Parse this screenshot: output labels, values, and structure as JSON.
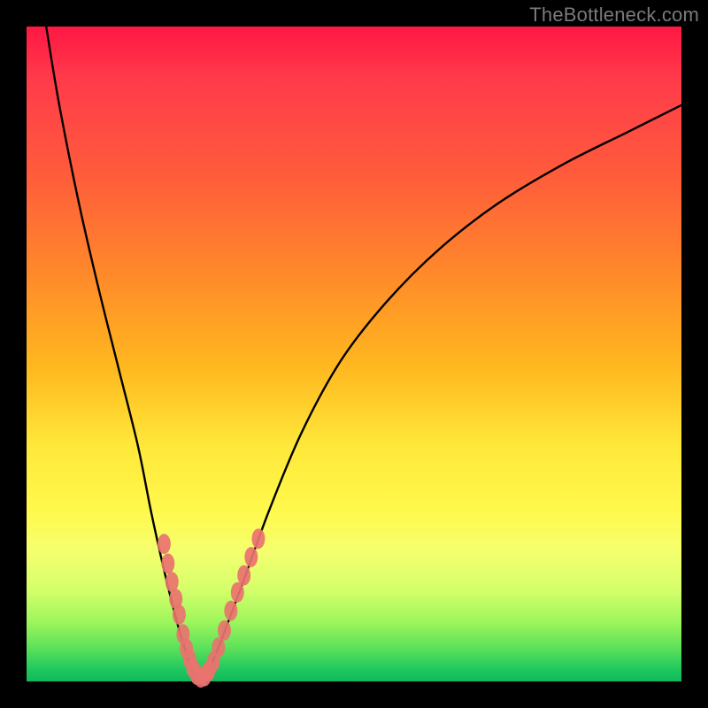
{
  "watermark": "TheBottleneck.com",
  "chart_data": {
    "type": "line",
    "title": "",
    "xlabel": "",
    "ylabel": "",
    "xlim": [
      0,
      100
    ],
    "ylim": [
      0,
      100
    ],
    "series": [
      {
        "name": "bottleneck-curve",
        "x": [
          3,
          5,
          8,
          11,
          14,
          17,
          19,
          21,
          23,
          24.5,
          26,
          27,
          28,
          30,
          33,
          37,
          42,
          48,
          55,
          63,
          72,
          82,
          92,
          100
        ],
        "y": [
          100,
          88,
          73,
          60,
          48,
          36,
          26,
          17,
          9,
          4,
          0,
          0,
          2,
          7,
          15,
          26,
          38,
          49,
          58,
          66,
          73,
          79,
          84,
          88
        ]
      }
    ],
    "markers": [
      {
        "x": 21.0,
        "y": 21.0,
        "r": 2.2
      },
      {
        "x": 21.6,
        "y": 18.0,
        "r": 2.2
      },
      {
        "x": 22.2,
        "y": 15.2,
        "r": 2.2
      },
      {
        "x": 22.8,
        "y": 12.6,
        "r": 2.2
      },
      {
        "x": 23.3,
        "y": 10.2,
        "r": 2.2
      },
      {
        "x": 23.9,
        "y": 7.2,
        "r": 2.2
      },
      {
        "x": 24.4,
        "y": 5.0,
        "r": 2.2
      },
      {
        "x": 24.9,
        "y": 3.4,
        "r": 2.2
      },
      {
        "x": 25.4,
        "y": 2.0,
        "r": 2.2
      },
      {
        "x": 26.0,
        "y": 1.0,
        "r": 2.2
      },
      {
        "x": 26.6,
        "y": 0.6,
        "r": 2.2
      },
      {
        "x": 27.2,
        "y": 0.8,
        "r": 2.2
      },
      {
        "x": 27.8,
        "y": 1.6,
        "r": 2.2
      },
      {
        "x": 28.5,
        "y": 3.0,
        "r": 2.2
      },
      {
        "x": 29.3,
        "y": 5.2,
        "r": 2.2
      },
      {
        "x": 30.2,
        "y": 7.8,
        "r": 2.2
      },
      {
        "x": 31.2,
        "y": 10.8,
        "r": 2.2
      },
      {
        "x": 32.2,
        "y": 13.6,
        "r": 2.2
      },
      {
        "x": 33.2,
        "y": 16.2,
        "r": 2.2
      },
      {
        "x": 34.3,
        "y": 19.0,
        "r": 2.2
      },
      {
        "x": 35.4,
        "y": 21.8,
        "r": 2.2
      }
    ],
    "gradient_stops": [
      {
        "pos": 0,
        "color": "#ff1744"
      },
      {
        "pos": 22,
        "color": "#ff5a3c"
      },
      {
        "pos": 52,
        "color": "#ffb81f"
      },
      {
        "pos": 74,
        "color": "#fff94c"
      },
      {
        "pos": 95,
        "color": "#5be05a"
      },
      {
        "pos": 100,
        "color": "#0fb85c"
      }
    ]
  }
}
